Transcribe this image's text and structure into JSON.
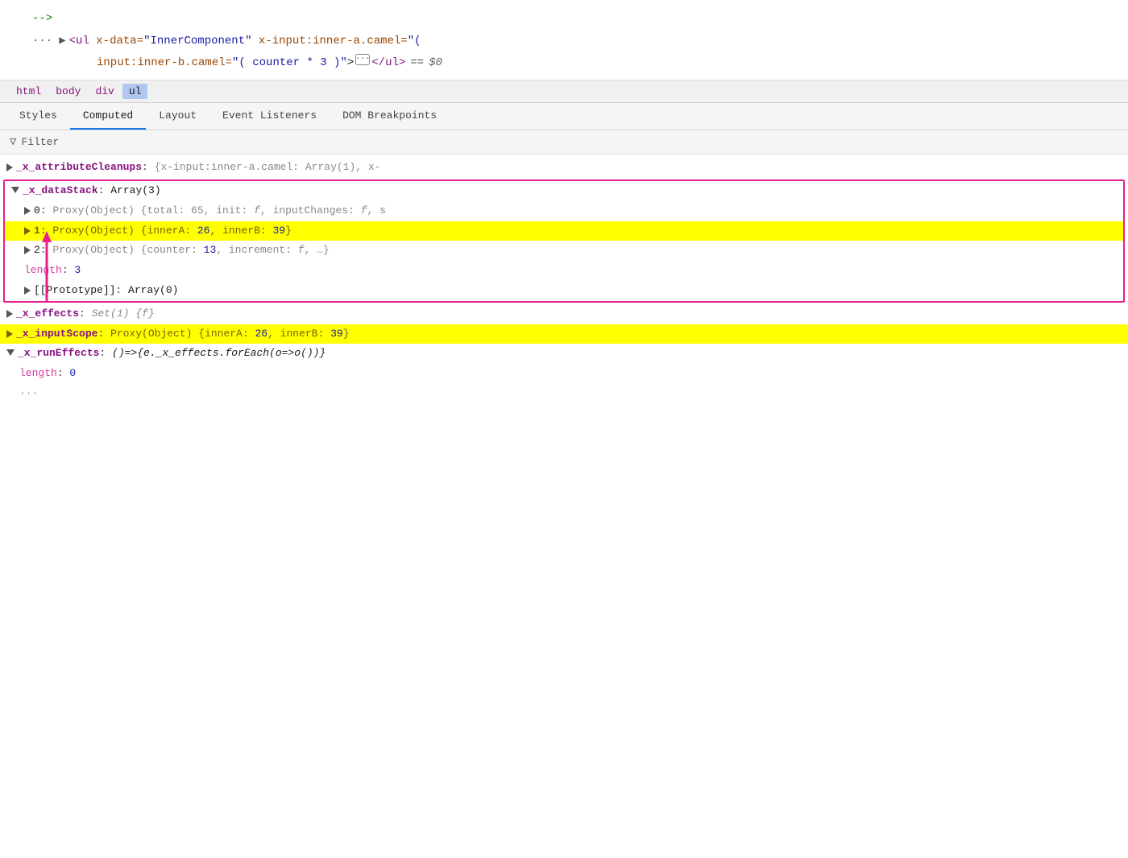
{
  "source": {
    "comment": "-->",
    "line1_prefix": "▶",
    "line1_tag_open": "<ul",
    "line1_attr1_name": "x-data=",
    "line1_attr1_value": "\"InnerComponent\"",
    "line1_attr2_name": "x-input:inner-a.camel=",
    "line1_attr2_value": "\"(",
    "line2_attr3_name": "input:inner-b.camel=",
    "line2_attr3_value": "\"( counter * 3 )\"",
    "line2_ellipsis": "···",
    "line2_tag_close": "</ul>",
    "line2_equals": "==",
    "line2_dollar": "$0"
  },
  "breadcrumb": {
    "items": [
      "html",
      "body",
      "div",
      "ul"
    ],
    "active": "ul"
  },
  "tabs": {
    "items": [
      "Styles",
      "Computed",
      "Layout",
      "Event Listeners",
      "DOM Breakpoints"
    ],
    "active": "Computed"
  },
  "filter": {
    "label": "Filter"
  },
  "properties": [
    {
      "id": "attributeCleanups",
      "indent": 0,
      "triangle": "right",
      "key": "_x_attributeCleanups",
      "key_bold": true,
      "key_color": "dark-purple",
      "colon": ":",
      "value": "{x-input:inner-a.camel: Array(1), x-",
      "value_color": "gray"
    },
    {
      "id": "dataStack",
      "indent": 0,
      "triangle": "down",
      "key": "_x_dataStack",
      "key_bold": true,
      "key_color": "dark-purple",
      "colon": ":",
      "value": "Array(3)",
      "value_color": "dark",
      "is_pink_box_start": true
    },
    {
      "id": "dataStack_0",
      "indent": 1,
      "triangle": "right",
      "key": "0",
      "key_bold": false,
      "key_color": "dark",
      "colon": ":",
      "value": "Proxy(Object) {total: 65, init: f, inputChanges: f, s",
      "value_color": "gray",
      "is_inside_pink": true
    },
    {
      "id": "dataStack_1",
      "indent": 1,
      "triangle": "right",
      "key": "1",
      "key_bold": true,
      "key_color": "olive",
      "colon": ":",
      "value": "Proxy(Object) {innerA: 26, innerB: 39}",
      "value_color": "olive",
      "highlight": true,
      "is_inside_pink": true
    },
    {
      "id": "dataStack_2",
      "indent": 1,
      "triangle": "right",
      "key": "2",
      "key_bold": false,
      "key_color": "dark",
      "colon": ":",
      "value": "Proxy(Object) {counter: 13, increment: f, …}",
      "value_color": "gray",
      "is_inside_pink": true
    },
    {
      "id": "length",
      "indent": 1,
      "triangle": "none",
      "key": "length",
      "key_bold": false,
      "key_color": "pink",
      "colon": ":",
      "value": "3",
      "value_color": "blue",
      "is_inside_pink": true
    },
    {
      "id": "prototype",
      "indent": 1,
      "triangle": "right",
      "key": "[[Prototype]]",
      "key_bold": false,
      "key_color": "dark",
      "colon": ":",
      "value": "Array(0)",
      "value_color": "dark",
      "is_inside_pink": true,
      "is_pink_box_end": true
    },
    {
      "id": "effects",
      "indent": 0,
      "triangle": "right",
      "key": "_x_effects",
      "key_bold": true,
      "key_color": "dark-purple",
      "colon": ":",
      "value": "Set(1) {f}",
      "value_color": "gray",
      "value_italic": true
    },
    {
      "id": "inputScope",
      "indent": 0,
      "triangle": "right",
      "key": "_x_inputScope",
      "key_bold": true,
      "key_color": "dark-purple",
      "colon": ":",
      "value": "Proxy(Object) {innerA: 26, innerB: 39}",
      "value_color": "olive",
      "highlight": true
    },
    {
      "id": "runEffects",
      "indent": 0,
      "triangle": "down",
      "key": "_x_runEffects",
      "key_bold": true,
      "key_color": "dark-purple",
      "colon": ":",
      "value": "()=>{e._x_effects.forEach(o=>o())}",
      "value_color": "dark",
      "value_italic": true
    },
    {
      "id": "runEffects_length",
      "indent": 1,
      "triangle": "none",
      "key": "length",
      "key_bold": false,
      "key_color": "pink",
      "colon": ":",
      "value": "0",
      "value_color": "blue"
    }
  ]
}
